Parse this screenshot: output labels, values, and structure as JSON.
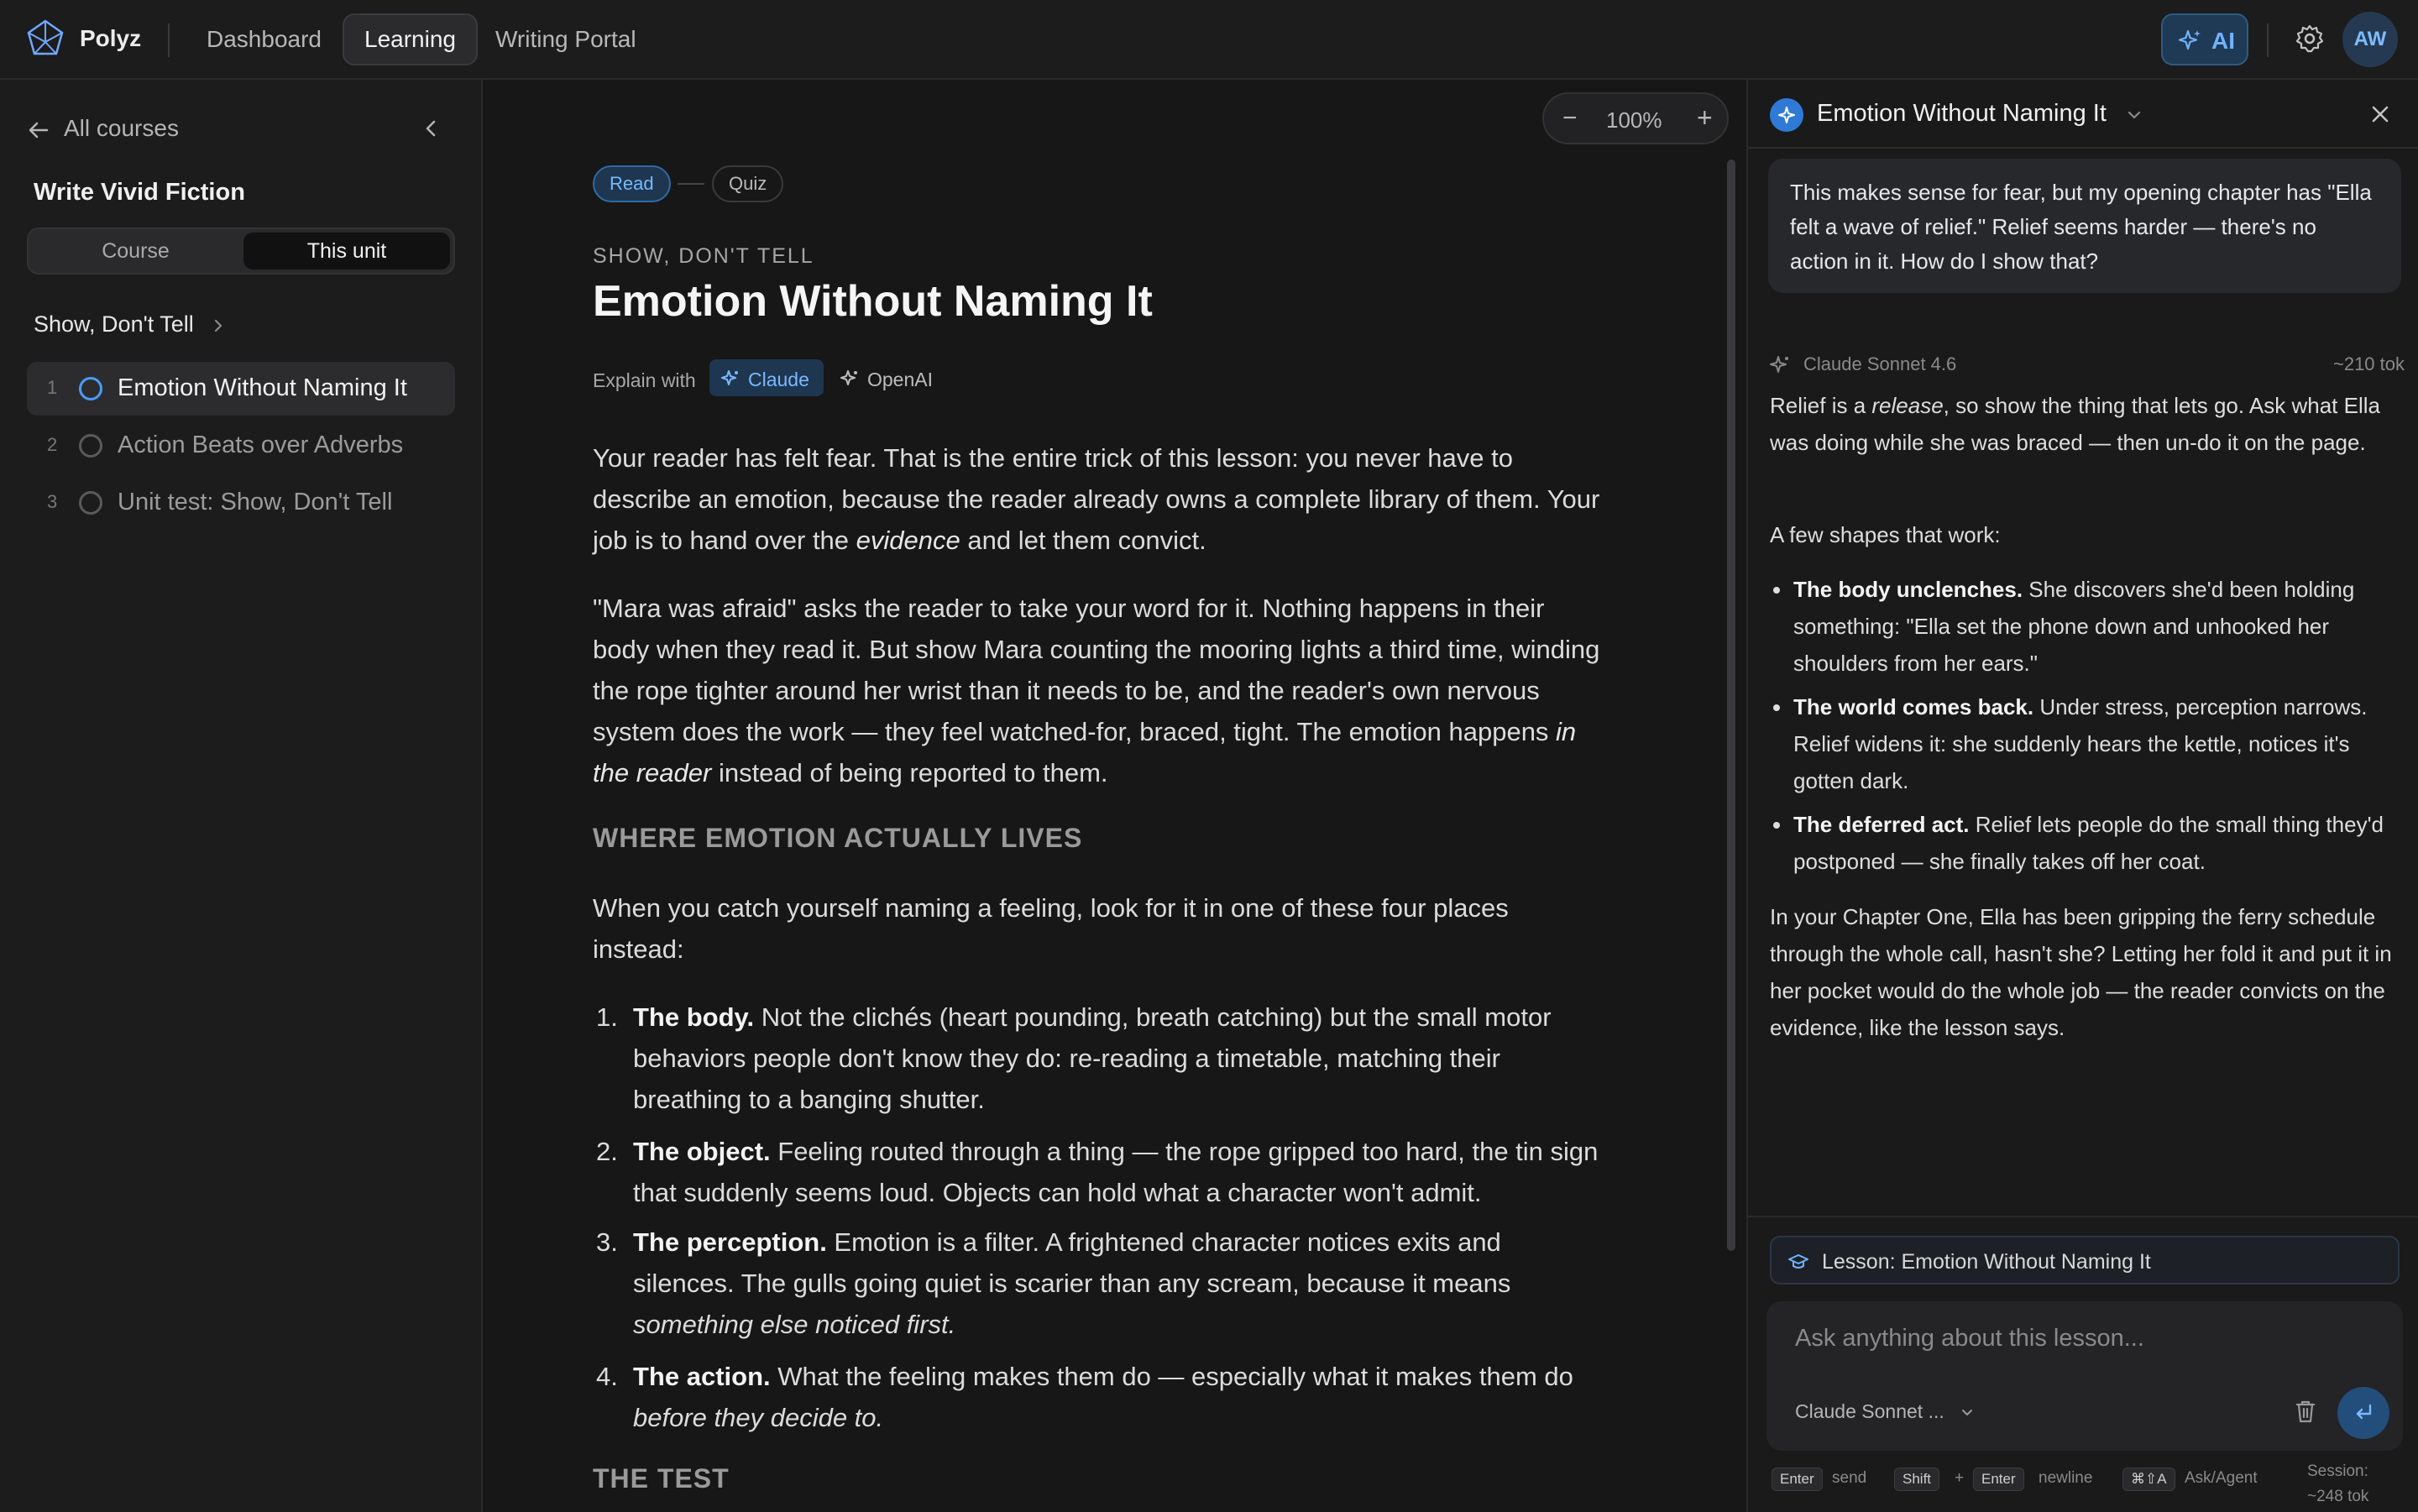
{
  "app": {
    "name": "Polyz"
  },
  "nav": {
    "items": [
      "Dashboard",
      "Learning",
      "Writing Portal"
    ],
    "active": "Learning"
  },
  "topbar": {
    "ai_label": "AI",
    "avatar_initials": "AW"
  },
  "sidebar": {
    "back_label": "All courses",
    "course_title": "Write Vivid Fiction",
    "scope_tabs": [
      "Course",
      "This unit"
    ],
    "active_scope": "This unit",
    "unit_title": "Show, Don't Tell",
    "lessons": [
      {
        "num": "1",
        "title": "Emotion Without Naming It",
        "active": true
      },
      {
        "num": "2",
        "title": "Action Beats over Adverbs",
        "active": false
      },
      {
        "num": "3",
        "title": "Unit test: Show, Don't Tell",
        "active": false
      }
    ]
  },
  "reader": {
    "zoom": {
      "minus": "−",
      "value": "100%",
      "plus": "+"
    },
    "steps": [
      "Read",
      "Quiz"
    ],
    "kicker": "SHOW, DON'T TELL",
    "title": "Emotion Without Naming It",
    "explain_label": "Explain with",
    "explain_options": [
      "Claude",
      "OpenAI"
    ],
    "p1": {
      "a": "Your reader has felt fear. That is the entire trick of this lesson: you never have to describe an emotion, because the reader already owns a complete library of them. Your job is to hand over the ",
      "em": "evidence",
      "b": " and let them convict."
    },
    "p2": {
      "a": "\"Mara was afraid\" asks the reader to take your word for it. Nothing happens in their body when they read it. But show Mara counting the mooring lights a third time, winding the rope tighter around her wrist than it needs to be, and the reader's own nervous system does the work — they feel watched-for, braced, tight. The emotion happens ",
      "em": "in the reader",
      "b": " instead of being reported to them."
    },
    "section1": "WHERE EMOTION ACTUALLY LIVES",
    "p3": "When you catch yourself naming a feeling, look for it in one of these four places instead:",
    "list": [
      {
        "n": "1.",
        "bold": "The body.",
        "text": " Not the clichés (heart pounding, breath catching) but the small motor behaviors people don't know they do: re-reading a timetable, matching their breathing to a banging shutter.",
        "em": ""
      },
      {
        "n": "2.",
        "bold": "The object.",
        "text": " Feeling routed through a thing — the rope gripped too hard, the tin sign that suddenly seems loud. Objects can hold what a character won't admit.",
        "em": ""
      },
      {
        "n": "3.",
        "bold": "The perception.",
        "text": " Emotion is a filter. A frightened character notices exits and silences. The gulls going quiet is scarier than any scream, because it means ",
        "em": "something else noticed first."
      },
      {
        "n": "4.",
        "bold": "The action.",
        "text": " What the feeling makes them do — especially what it makes them do ",
        "em": "before they decide to."
      }
    ],
    "section2": "THE TEST"
  },
  "ai_panel": {
    "title": "Emotion Without Naming It",
    "user_message": "This makes sense for fear, but my opening chapter has \"Ella felt a wave of relief.\" Relief seems harder — there's no action in it. How do I show that?",
    "model_name": "Claude Sonnet 4.6",
    "token_count": "~210 tok",
    "r1": {
      "a": "Relief is a ",
      "em": "release",
      "b": ", so show the thing that lets go. Ask what Ella was doing while she was braced — then un-do it on the page."
    },
    "r2": "A few shapes that work:",
    "bullets": [
      {
        "bold": "The body unclenches.",
        "text": " She discovers she'd been holding something: \"Ella set the phone down and unhooked her shoulders from her ears.\""
      },
      {
        "bold": "The world comes back.",
        "text": " Under stress, perception narrows. Relief widens it: she suddenly hears the kettle, notices it's gotten dark."
      },
      {
        "bold": "The deferred act.",
        "text": " Relief lets people do the small thing they'd postponed — she finally takes off her coat."
      }
    ],
    "r3": "In your Chapter One, Ella has been gripping the ferry schedule through the whole call, hasn't she? Letting her fold it and put it in her pocket would do the whole job — the reader convicts on the evidence, like the lesson says.",
    "context_chip": "Lesson: Emotion Without Naming It",
    "input_placeholder": "Ask anything about this lesson...",
    "model_select": "Claude Sonnet ...",
    "hints": {
      "enter": "Enter",
      "send": "send",
      "shift": "Shift",
      "plus": "+",
      "enter2": "Enter",
      "newline": "newline",
      "mode_key": "⌘⇧A",
      "mode": "Ask/Agent",
      "session": "Session: ~248 tok"
    }
  },
  "colors": {
    "accent": "#4a9bff",
    "background": "#161616",
    "panel": "#1c1c1d"
  }
}
